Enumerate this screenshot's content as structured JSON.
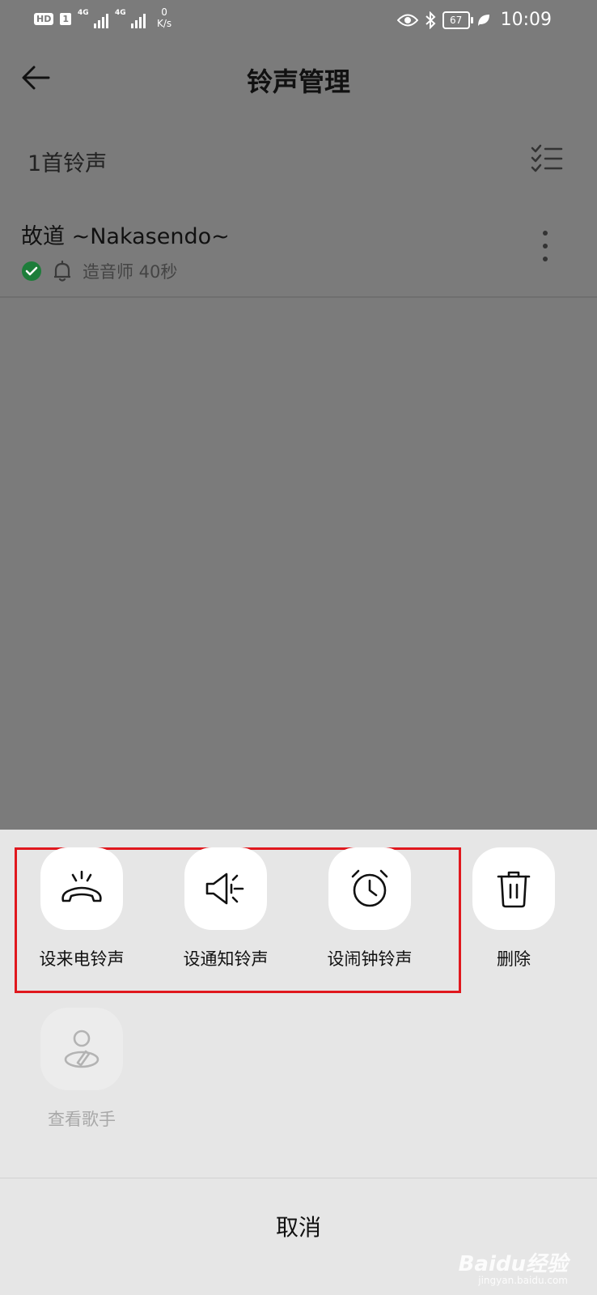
{
  "status_bar": {
    "hd_label": "HD",
    "sim_label": "1",
    "net1_label": "4G",
    "net2_label": "4G",
    "speed_value": "0",
    "speed_unit": "K/s",
    "battery_level": "67",
    "time": "10:09"
  },
  "header": {
    "title": "铃声管理"
  },
  "list": {
    "count_label": "1首铃声",
    "items": [
      {
        "title": "故道 ~Nakasendo~",
        "meta": "造音师 40秒"
      }
    ]
  },
  "action_sheet": {
    "actions": [
      {
        "label": "设来电铃声",
        "icon": "phone-ringing-icon"
      },
      {
        "label": "设通知铃声",
        "icon": "speaker-icon"
      },
      {
        "label": "设闹钟铃声",
        "icon": "alarm-clock-icon"
      },
      {
        "label": "删除",
        "icon": "trash-icon"
      },
      {
        "label": "查看歌手",
        "icon": "singer-icon"
      }
    ],
    "cancel_label": "取消",
    "highlight_color": "#e0181e"
  },
  "watermark": {
    "main": "Baidu经验",
    "sub": "jingyan.baidu.com"
  }
}
